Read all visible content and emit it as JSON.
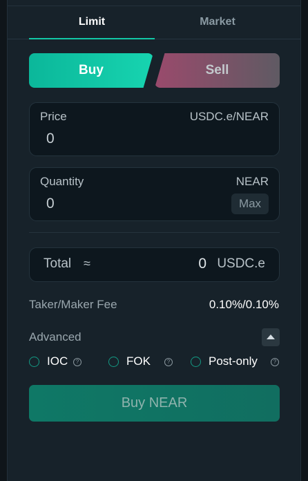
{
  "tabs": [
    {
      "label": "Limit",
      "active": true
    },
    {
      "label": "Market",
      "active": false
    }
  ],
  "side": {
    "buy_label": "Buy",
    "sell_label": "Sell",
    "selected": "Buy"
  },
  "price": {
    "label": "Price",
    "unit": "USDC.e/NEAR",
    "value": "0"
  },
  "quantity": {
    "label": "Quantity",
    "unit": "NEAR",
    "value": "0",
    "max_label": "Max"
  },
  "total": {
    "label": "Total",
    "approx": "≈",
    "value": "0",
    "unit": "USDC.e"
  },
  "fee": {
    "label": "Taker/Maker Fee",
    "value": "0.10%/0.10%"
  },
  "advanced": {
    "label": "Advanced",
    "expanded": true,
    "toggle_icon": "chevron-up-icon",
    "options": [
      {
        "label": "IOC",
        "selected": false,
        "help_icon": "question-icon"
      },
      {
        "label": "FOK",
        "selected": false,
        "help_icon": "question-icon"
      },
      {
        "label": "Post-only",
        "selected": false,
        "help_icon": "question-icon"
      }
    ]
  },
  "submit": {
    "label": "Buy NEAR"
  },
  "colors": {
    "accent": "#12c8a6",
    "buy": "#12c5a4",
    "sell": "#9a4a6c",
    "background": "#17222a"
  }
}
